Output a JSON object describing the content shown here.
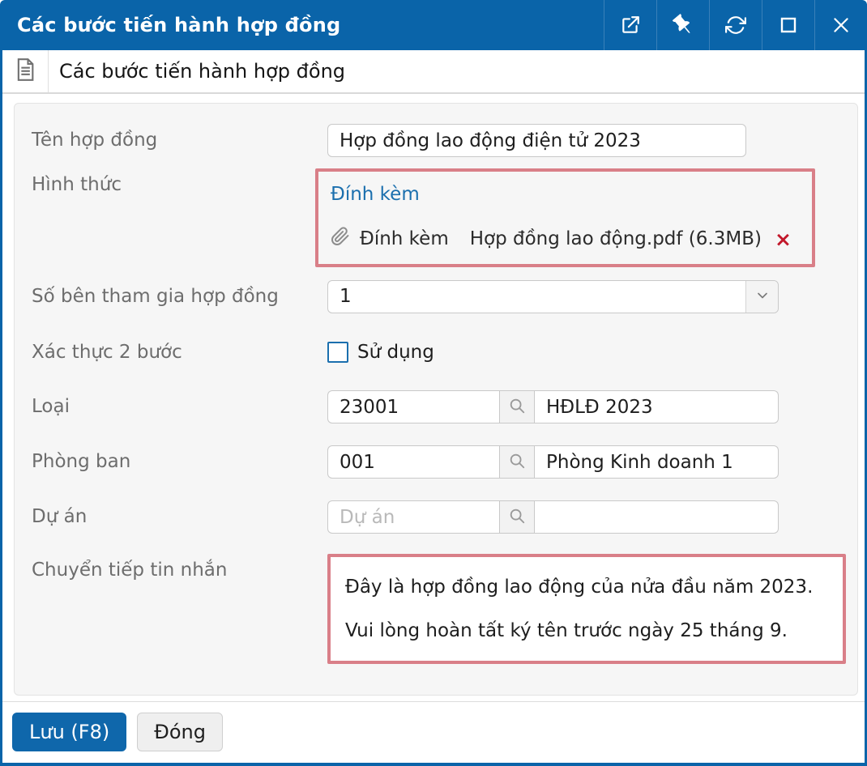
{
  "titlebar": {
    "title": "Các bước tiến hành hợp đồng",
    "buttons": [
      {
        "name": "open-in-new-window",
        "icon": "external-link-icon"
      },
      {
        "name": "pin-window",
        "icon": "pin-icon"
      },
      {
        "name": "refresh-window",
        "icon": "refresh-icon"
      },
      {
        "name": "maximize-window",
        "icon": "maximize-icon"
      },
      {
        "name": "close-window",
        "icon": "close-icon"
      }
    ]
  },
  "tabbar": {
    "icon": "document-icon",
    "title": "Các bước tiến hành hợp đồng"
  },
  "form": {
    "contract_name": {
      "label": "Tên hợp đồng",
      "value": "Hợp đồng lao động điện tử 2023"
    },
    "attachment_section": {
      "label": "Hình thức",
      "link_label": "Đính kèm",
      "attach_button_label": "Đính kèm",
      "file_name": "Hợp đồng lao động.pdf (6.3MB)",
      "remove_label": "×"
    },
    "parties": {
      "label": "Số bên tham gia hợp đồng",
      "selected": "1"
    },
    "two_step": {
      "label": "Xác thực 2 bước",
      "option_label": "Sử dụng",
      "checked": false
    },
    "type": {
      "label": "Loại",
      "code": "23001",
      "name": "HĐLĐ 2023"
    },
    "department": {
      "label": "Phòng ban",
      "code": "001",
      "name": "Phòng Kinh doanh 1"
    },
    "project": {
      "label": "Dự án",
      "code_placeholder": "Dự án",
      "name": ""
    },
    "forward_message": {
      "label": "Chuyển tiếp tin nhắn",
      "lines": [
        "Đây là hợp đồng lao động của nửa đầu năm 2023.",
        "Vui lòng hoàn tất ký tên trước ngày 25 tháng 9."
      ]
    }
  },
  "footer": {
    "save_label": "Lưu (F8)",
    "close_label": "Đóng"
  },
  "colors": {
    "titlebar_blue": "#0a64a9",
    "accent_blue": "#0f67ab",
    "link_blue": "#1b6fae",
    "highlight_border": "#d97f88",
    "remove_red": "#c2182b",
    "panel_bg": "#f6f6f6"
  }
}
